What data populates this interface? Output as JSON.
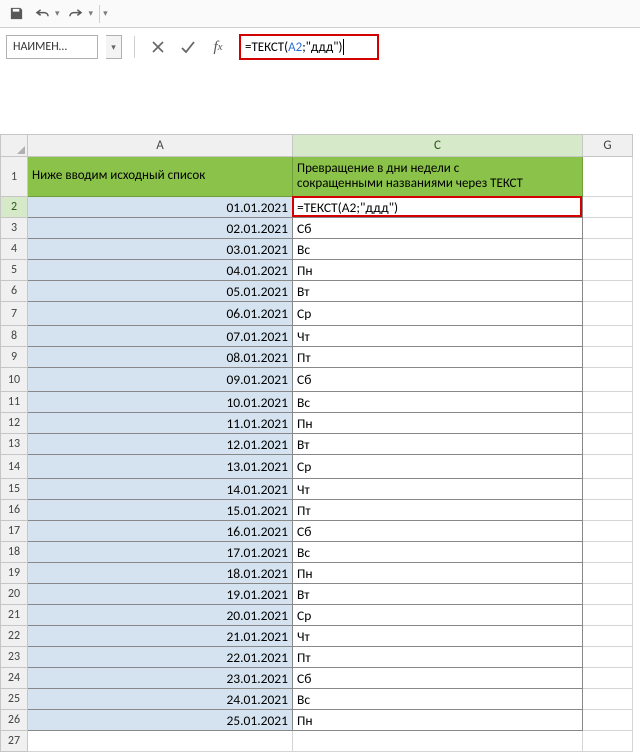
{
  "qat": {
    "save": "save-icon",
    "undo": "undo-icon",
    "redo": "redo-icon"
  },
  "namebox": {
    "value": "НАИМЕН…"
  },
  "formula_bar": {
    "prefix": "=ТЕКСТ(",
    "ref": "A2",
    "suffix": ";\"ддд\")"
  },
  "columns": {
    "A": "A",
    "C": "C",
    "G": "G"
  },
  "headers": {
    "A": "Ниже вводим исходный список",
    "C": "Превращение в дни недели с\nсокращенными названиями через ТЕКСТ"
  },
  "editing_cell_text": "=ТЕКСТ(A2;\"ддд\")",
  "rows": [
    {
      "n": "1"
    },
    {
      "n": "2",
      "date": "01.01.2021",
      "day": ""
    },
    {
      "n": "3",
      "date": "02.01.2021",
      "day": "Сб"
    },
    {
      "n": "4",
      "date": "03.01.2021",
      "day": "Вс"
    },
    {
      "n": "5",
      "date": "04.01.2021",
      "day": "Пн"
    },
    {
      "n": "6",
      "date": "05.01.2021",
      "day": "Вт"
    },
    {
      "n": "7",
      "date": "06.01.2021",
      "day": "Ср"
    },
    {
      "n": "8",
      "date": "07.01.2021",
      "day": "Чт"
    },
    {
      "n": "9",
      "date": "08.01.2021",
      "day": "Пт"
    },
    {
      "n": "10",
      "date": "09.01.2021",
      "day": "Сб"
    },
    {
      "n": "11",
      "date": "10.01.2021",
      "day": "Вс"
    },
    {
      "n": "12",
      "date": "11.01.2021",
      "day": "Пн"
    },
    {
      "n": "13",
      "date": "12.01.2021",
      "day": "Вт"
    },
    {
      "n": "14",
      "date": "13.01.2021",
      "day": "Ср"
    },
    {
      "n": "15",
      "date": "14.01.2021",
      "day": "Чт"
    },
    {
      "n": "16",
      "date": "15.01.2021",
      "day": "Пт"
    },
    {
      "n": "17",
      "date": "16.01.2021",
      "day": "Сб"
    },
    {
      "n": "18",
      "date": "17.01.2021",
      "day": "Вс"
    },
    {
      "n": "19",
      "date": "18.01.2021",
      "day": "Пн"
    },
    {
      "n": "20",
      "date": "19.01.2021",
      "day": "Вт"
    },
    {
      "n": "21",
      "date": "20.01.2021",
      "day": "Ср"
    },
    {
      "n": "22",
      "date": "21.01.2021",
      "day": "Чт"
    },
    {
      "n": "23",
      "date": "22.01.2021",
      "day": "Пт"
    },
    {
      "n": "24",
      "date": "23.01.2021",
      "day": "Сб"
    },
    {
      "n": "25",
      "date": "24.01.2021",
      "day": "Вс"
    },
    {
      "n": "26",
      "date": "25.01.2021",
      "day": "Пн"
    },
    {
      "n": "27"
    }
  ]
}
